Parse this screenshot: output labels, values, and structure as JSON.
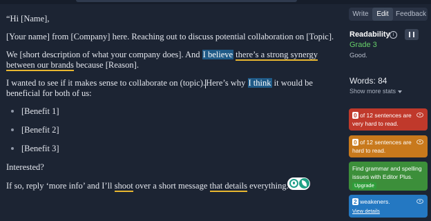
{
  "editor": {
    "greeting": "“Hi [Name],",
    "intro": "[Your name] from [Company] here. Reaching out to discuss potential collaboration on [Topic].",
    "desc": {
      "p1": "We [short description of what your company does]. And ",
      "hl1": "I believe",
      "sp1": " ",
      "ul1": "there’s a strong synergy",
      "ul2": "between our brands",
      "p2": " because [Reason]."
    },
    "collab": {
      "p1": "I wanted to see if it makes sense to collaborate on (topic).",
      "p2": "Here’s why ",
      "hl1": "I think",
      "p3": " it would be",
      "line2": "beneficial for both of us:"
    },
    "bullets": [
      "[Benefit 1]",
      "[Benefit 2]",
      "[Benefit 3]"
    ],
    "interested": "Interested?",
    "closing": {
      "p1": "If so, reply ‘more info’ and I’ll ",
      "ul1": "shoot",
      "p2": " over a short message ",
      "ul2": "that details",
      "p3": " everything.”"
    }
  },
  "sidebar": {
    "tabs": [
      "Write",
      "Edit",
      "Feedback"
    ],
    "active_tab": "Edit",
    "readability": {
      "title": "Readability",
      "grade": "Grade 3",
      "rating": "Good."
    },
    "words": "Words: 84",
    "show_more": "Show more stats",
    "cards": {
      "very_hard": {
        "count": "0",
        "text1": "of 12 sentences are",
        "text2": "very hard to read.",
        "color": "#c0392b"
      },
      "hard": {
        "count": "0",
        "text1": "of 12 sentences are",
        "text2": "hard to read.",
        "color": "#c8791c"
      },
      "grammar": {
        "text1": "Find grammar and spelling",
        "text2": "issues with Editor Plus.",
        "upgrade": "Upgrade",
        "color": "#3c8f3a"
      },
      "weakeners": {
        "count": "2",
        "text1": "weakeners.",
        "link": "View details",
        "color": "#2478c2"
      }
    }
  }
}
